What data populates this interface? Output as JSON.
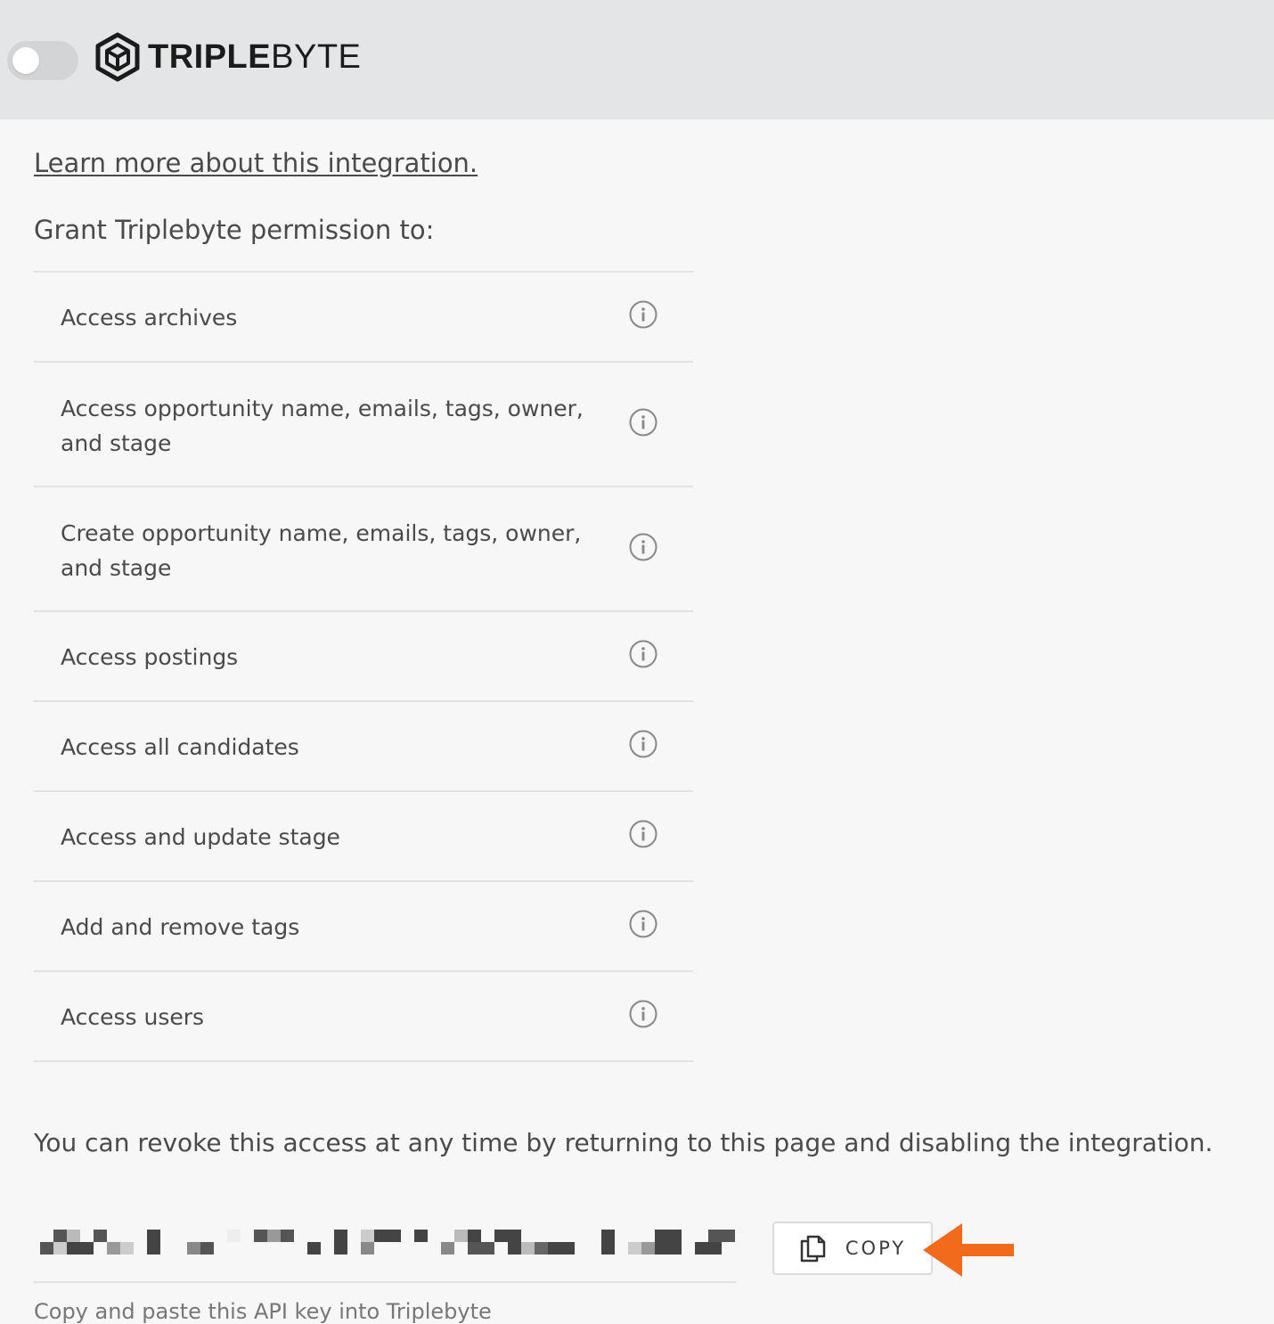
{
  "header": {
    "toggle_state": "off",
    "logo": {
      "text_bold": "TRIPLE",
      "text_regular": "BYTE"
    }
  },
  "main": {
    "learn_more_link": "Learn more about this integration.",
    "grant_label": "Grant Triplebyte permission to:",
    "permissions": [
      {
        "label": "Access archives"
      },
      {
        "label": "Access opportunity name, emails, tags, owner, and stage"
      },
      {
        "label": "Create opportunity name, emails, tags, owner, and stage"
      },
      {
        "label": "Access postings"
      },
      {
        "label": "Access all candidates"
      },
      {
        "label": "Access and update stage"
      },
      {
        "label": "Add and remove tags"
      },
      {
        "label": "Access users"
      }
    ],
    "revoke_text": "You can revoke this access at any time by returning to this page and disabling the integration.",
    "api_key_state": "redacted",
    "copy_button_label": "COPY",
    "footnote_partial": "Copy and paste this API key into Triplebyte"
  },
  "colors": {
    "header_bg": "#e4e5e7",
    "page_bg": "#f7f7f7",
    "arrow_accent": "#f26a1b",
    "text": "#4a4a4a"
  },
  "icons": {
    "info": "info-circle-icon",
    "copy": "copy-icon",
    "logo": "hexagon-cube-icon",
    "annotation": "arrow-left-icon"
  }
}
